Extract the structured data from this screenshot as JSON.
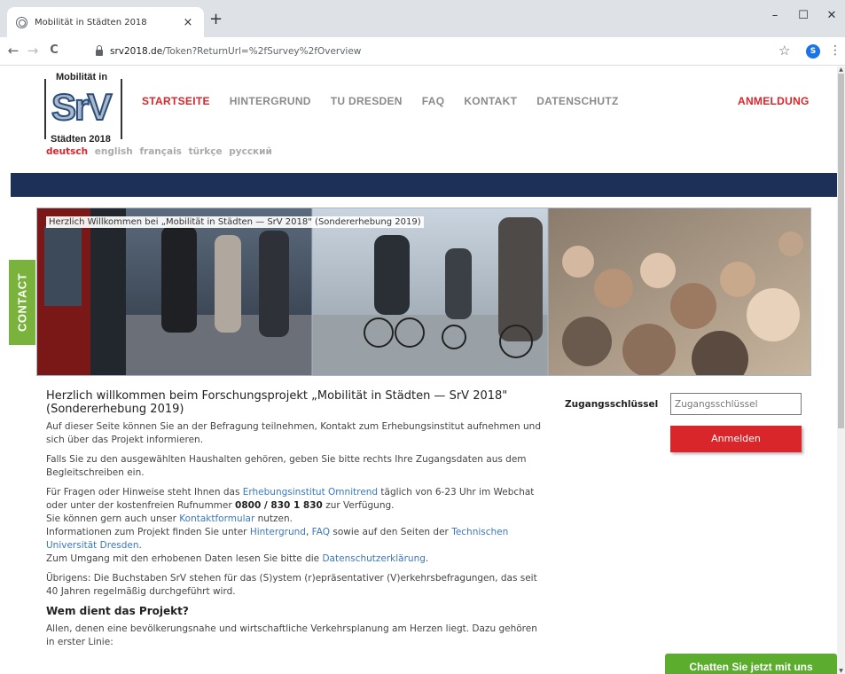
{
  "browser": {
    "tab_title": "Mobilität in Städten 2018",
    "tab_close": "×",
    "new_tab": "+",
    "url_domain": "srv2018.de",
    "url_path": "/Token?ReturnUrl=%2fSurvey%2fOverview",
    "profile_initial": "S",
    "minimize": "–",
    "maximize": "☐",
    "close": "✕",
    "back": "←",
    "forward": "→",
    "reload": "C",
    "star": "☆",
    "menu": "⋮"
  },
  "logo": {
    "top": "Mobilität in",
    "srv": "SrV",
    "bottom": "Städten 2018"
  },
  "nav": {
    "items": [
      "STARTSEITE",
      "HINTERGRUND",
      "TU DRESDEN",
      "FAQ",
      "KONTAKT",
      "DATENSCHUTZ"
    ],
    "login": "ANMELDUNG"
  },
  "languages": [
    "deutsch",
    "english",
    "français",
    "türkçe",
    "русский"
  ],
  "banner": {
    "caption": "Herzlich Willkommen bei „Mobilität in Städten — SrV 2018\" (Sondererhebung 2019)"
  },
  "contact_tab": "CONTACT",
  "content": {
    "heading": "Herzlich willkommen beim Forschungsprojekt „Mobilität in Städten — SrV 2018\" (Sondererhebung 2019)",
    "p1": "Auf dieser Seite können Sie an der Befragung teilnehmen, Kontakt zum Erhebungsinstitut aufnehmen und sich über das Projekt informieren.",
    "p2": "Falls Sie zu den ausgewählten Haushalten gehören, geben Sie bitte rechts Ihre Zugangsdaten aus dem Begleitschreiben ein.",
    "p3_a": "Für Fragen oder Hinweise steht Ihnen das ",
    "p3_link_omnitrend": "Erhebungsinstitut Omnitrend",
    "p3_b": " täglich von 6-23 Uhr im Webchat oder unter der kostenfreien Rufnummer ",
    "p3_phone": "0800 / 830 1 830",
    "p3_c": " zur Verfügung.",
    "p3_d": "Sie können gern auch unser ",
    "p3_link_kontakt": "Kontaktformular",
    "p3_e": " nutzen.",
    "p3_f": "Informationen zum Projekt finden Sie unter ",
    "p3_link_hintergrund": "Hintergrund",
    "p3_comma": ", ",
    "p3_link_faq": "FAQ",
    "p3_g": " sowie auf den Seiten der ",
    "p3_link_tu": "Technischen Universität Dresden",
    "p3_dot": ".",
    "p3_h": "Zum Umgang mit den erhobenen Daten lesen Sie bitte die ",
    "p3_link_datenschutz": "Datenschutzerklärung",
    "p3_end": ".",
    "p4": "Übrigens: Die Buchstaben SrV stehen für das (S)ystem (r)epräsentativer (V)erkehrsbefragungen, das seit 40 Jahren regelmäßig durchgeführt wird.",
    "h2": "Wem dient das Projekt?",
    "p5": "Allen, denen eine bevölkerungsnahe und wirtschaftliche Verkehrsplanung am Herzen liegt. Dazu gehören in erster Linie:"
  },
  "login_form": {
    "label": "Zugangsschlüssel",
    "placeholder": "Zugangsschlüssel",
    "button": "Anmelden"
  },
  "chat_button": "Chatten Sie jetzt mit uns"
}
